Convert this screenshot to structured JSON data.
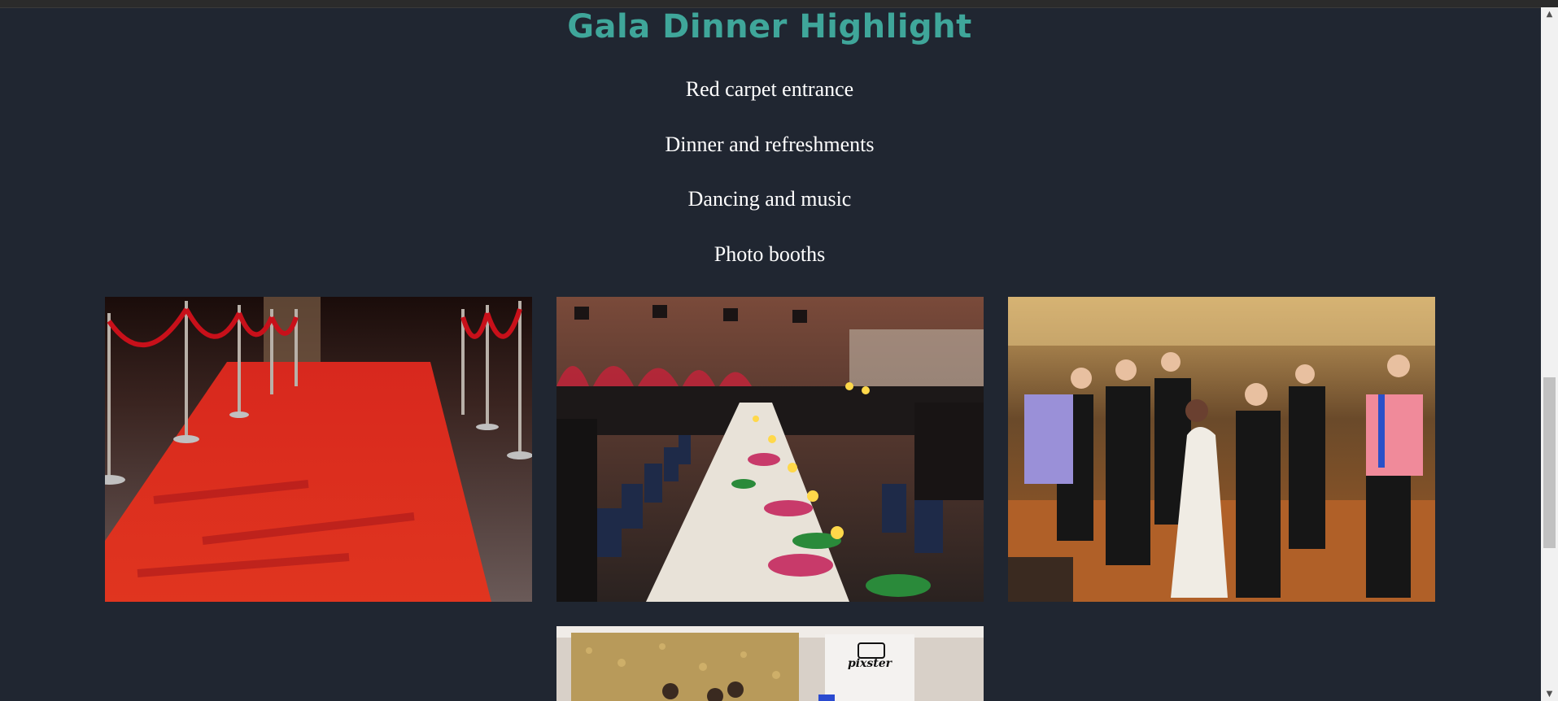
{
  "section": {
    "title": "Gala Dinner Highlight",
    "highlights": [
      "Red carpet entrance",
      "Dinner and refreshments",
      "Dancing and music",
      "Photo booths"
    ]
  },
  "gallery": {
    "booth_sign": "pixster"
  },
  "colors": {
    "background": "#202631",
    "title": "#3fa69a",
    "text": "#ffffff"
  },
  "scrollbar": {
    "up_glyph": "▲",
    "down_glyph": "▼"
  }
}
